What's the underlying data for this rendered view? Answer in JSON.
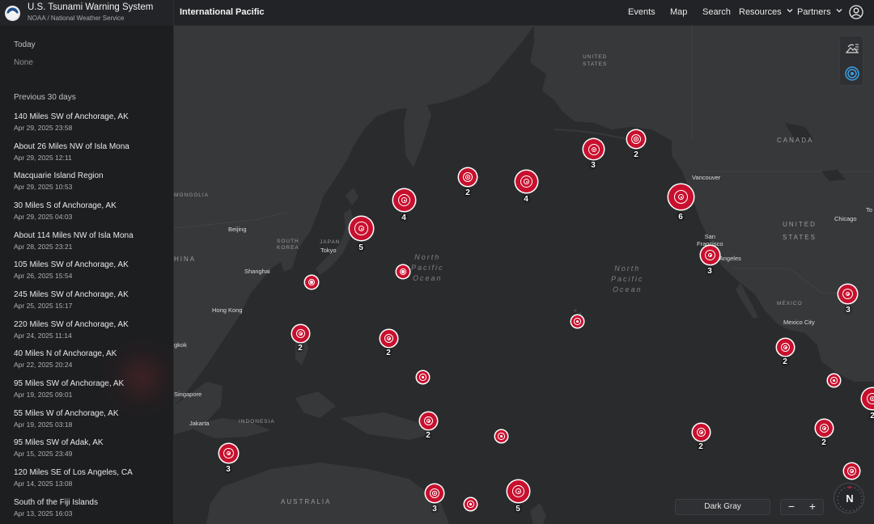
{
  "header": {
    "app_title": "U.S. Tsunami Warning System",
    "app_subtitle": "NOAA / National Weather Service",
    "region_title": "International Pacific",
    "nav": {
      "events": "Events",
      "map": "Map",
      "search": "Search",
      "resources": "Resources",
      "partners": "Partners"
    },
    "icons": {
      "logo": "noaa-logo-icon",
      "user": "user-account-icon",
      "dropdown": "chevron-down-icon"
    }
  },
  "sidebar": {
    "today_label": "Today",
    "today_none": "None",
    "previous_label": "Previous 30 days",
    "events": [
      {
        "title": "140 Miles SW of Anchorage, AK",
        "date": "Apr 29, 2025 23:58"
      },
      {
        "title": "About 26 Miles NW of Isla Mona",
        "date": "Apr 29, 2025 12:11"
      },
      {
        "title": "Macquarie Island Region",
        "date": "Apr 29, 2025 10:53"
      },
      {
        "title": "30 Miles S of Anchorage, AK",
        "date": "Apr 29, 2025 04:03"
      },
      {
        "title": "About 114 Miles NW of Isla Mona",
        "date": "Apr 28, 2025 23:21"
      },
      {
        "title": "105 Miles SW of Anchorage, AK",
        "date": "Apr 26, 2025 15:54"
      },
      {
        "title": "245 Miles SW of Anchorage, AK",
        "date": "Apr 25, 2025 15:17"
      },
      {
        "title": "220 Miles SW of Anchorage, AK",
        "date": "Apr 24, 2025 11:14"
      },
      {
        "title": "40 Miles N of Anchorage, AK",
        "date": "Apr 22, 2025 20:24"
      },
      {
        "title": "95 Miles SW of Anchorage, AK",
        "date": "Apr 19, 2025 09:01"
      },
      {
        "title": "55 Miles W of Anchorage, AK",
        "date": "Apr 19, 2025 03:18"
      },
      {
        "title": "95 Miles SW of Adak, AK",
        "date": "Apr 15, 2025 23:49"
      },
      {
        "title": "120 Miles SE of Los Angeles, CA",
        "date": "Apr 14, 2025 13:08"
      },
      {
        "title": "South of the Fiji Islands",
        "date": "Apr 13, 2025 16:03"
      }
    ]
  },
  "map": {
    "places": {
      "united_states_north": "UNITED\nSTATES",
      "canada": "CANADA",
      "vancouver": "Vancouver",
      "united_states": "UNITED\nSTATES",
      "chicago": "Chicago",
      "to": "To",
      "san_francisco": "San\nFrancisco",
      "los_angeles": "Los Angeles",
      "mexico": "MÉXICO",
      "mexico_city": "Mexico City",
      "mongolia": "MONGOLIA",
      "beijing": "Beijing",
      "south_korea": "SOUTH\nKOREA",
      "japan": "JAPAN",
      "tokyo": "Tokyo",
      "china": "HINA",
      "shanghai": "Shanghai",
      "hong_kong": "Hong Kong",
      "bangkok": "gkok",
      "singapore": "Singapore",
      "jakarta": "Jakarta",
      "indonesia": "INDONESIA",
      "australia": "AUSTRALIA",
      "north_pacific_ocean_1": "North\nPacific\nOcean",
      "north_pacific_ocean_2": "North\nPacific\nOcean"
    },
    "clusters": [
      {
        "count": "2"
      },
      {
        "count": "3"
      },
      {
        "count": "2"
      },
      {
        "count": "4"
      },
      {
        "count": "4"
      },
      {
        "count": "6"
      },
      {
        "count": "5"
      },
      {
        "count": ""
      },
      {
        "count": ""
      },
      {
        "count": "3"
      },
      {
        "count": "3"
      },
      {
        "count": "2"
      },
      {
        "count": "2"
      },
      {
        "count": ""
      },
      {
        "count": "2"
      },
      {
        "count": ""
      },
      {
        "count": ""
      },
      {
        "count": "2"
      },
      {
        "count": ""
      },
      {
        "count": "2"
      },
      {
        "count": "2"
      },
      {
        "count": "3"
      },
      {
        "count": "3"
      },
      {
        "count": ""
      },
      {
        "count": "5"
      },
      {
        "count": ""
      },
      {
        "count": "2"
      }
    ],
    "basemap_label": "Dark Gray",
    "zoom_out": "−",
    "zoom_in": "+",
    "compass_label": "N",
    "tools": {
      "layers": "layers-icon",
      "tsunami": "tsunami-target-icon"
    }
  },
  "colors": {
    "marker_red": "#c8102e",
    "tool_accent": "#3ba0e6",
    "land": "#37383a",
    "water": "#2a2b2d"
  }
}
